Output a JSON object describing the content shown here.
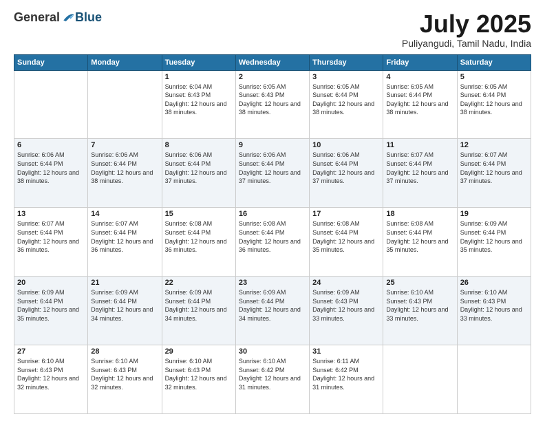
{
  "logo": {
    "general": "General",
    "blue": "Blue"
  },
  "header": {
    "month": "July 2025",
    "location": "Puliyangudi, Tamil Nadu, India"
  },
  "days": [
    "Sunday",
    "Monday",
    "Tuesday",
    "Wednesday",
    "Thursday",
    "Friday",
    "Saturday"
  ],
  "weeks": [
    [
      {
        "day": "",
        "info": ""
      },
      {
        "day": "",
        "info": ""
      },
      {
        "day": "1",
        "info": "Sunrise: 6:04 AM\nSunset: 6:43 PM\nDaylight: 12 hours and 38 minutes."
      },
      {
        "day": "2",
        "info": "Sunrise: 6:05 AM\nSunset: 6:43 PM\nDaylight: 12 hours and 38 minutes."
      },
      {
        "day": "3",
        "info": "Sunrise: 6:05 AM\nSunset: 6:44 PM\nDaylight: 12 hours and 38 minutes."
      },
      {
        "day": "4",
        "info": "Sunrise: 6:05 AM\nSunset: 6:44 PM\nDaylight: 12 hours and 38 minutes."
      },
      {
        "day": "5",
        "info": "Sunrise: 6:05 AM\nSunset: 6:44 PM\nDaylight: 12 hours and 38 minutes."
      }
    ],
    [
      {
        "day": "6",
        "info": "Sunrise: 6:06 AM\nSunset: 6:44 PM\nDaylight: 12 hours and 38 minutes."
      },
      {
        "day": "7",
        "info": "Sunrise: 6:06 AM\nSunset: 6:44 PM\nDaylight: 12 hours and 38 minutes."
      },
      {
        "day": "8",
        "info": "Sunrise: 6:06 AM\nSunset: 6:44 PM\nDaylight: 12 hours and 37 minutes."
      },
      {
        "day": "9",
        "info": "Sunrise: 6:06 AM\nSunset: 6:44 PM\nDaylight: 12 hours and 37 minutes."
      },
      {
        "day": "10",
        "info": "Sunrise: 6:06 AM\nSunset: 6:44 PM\nDaylight: 12 hours and 37 minutes."
      },
      {
        "day": "11",
        "info": "Sunrise: 6:07 AM\nSunset: 6:44 PM\nDaylight: 12 hours and 37 minutes."
      },
      {
        "day": "12",
        "info": "Sunrise: 6:07 AM\nSunset: 6:44 PM\nDaylight: 12 hours and 37 minutes."
      }
    ],
    [
      {
        "day": "13",
        "info": "Sunrise: 6:07 AM\nSunset: 6:44 PM\nDaylight: 12 hours and 36 minutes."
      },
      {
        "day": "14",
        "info": "Sunrise: 6:07 AM\nSunset: 6:44 PM\nDaylight: 12 hours and 36 minutes."
      },
      {
        "day": "15",
        "info": "Sunrise: 6:08 AM\nSunset: 6:44 PM\nDaylight: 12 hours and 36 minutes."
      },
      {
        "day": "16",
        "info": "Sunrise: 6:08 AM\nSunset: 6:44 PM\nDaylight: 12 hours and 36 minutes."
      },
      {
        "day": "17",
        "info": "Sunrise: 6:08 AM\nSunset: 6:44 PM\nDaylight: 12 hours and 35 minutes."
      },
      {
        "day": "18",
        "info": "Sunrise: 6:08 AM\nSunset: 6:44 PM\nDaylight: 12 hours and 35 minutes."
      },
      {
        "day": "19",
        "info": "Sunrise: 6:09 AM\nSunset: 6:44 PM\nDaylight: 12 hours and 35 minutes."
      }
    ],
    [
      {
        "day": "20",
        "info": "Sunrise: 6:09 AM\nSunset: 6:44 PM\nDaylight: 12 hours and 35 minutes."
      },
      {
        "day": "21",
        "info": "Sunrise: 6:09 AM\nSunset: 6:44 PM\nDaylight: 12 hours and 34 minutes."
      },
      {
        "day": "22",
        "info": "Sunrise: 6:09 AM\nSunset: 6:44 PM\nDaylight: 12 hours and 34 minutes."
      },
      {
        "day": "23",
        "info": "Sunrise: 6:09 AM\nSunset: 6:44 PM\nDaylight: 12 hours and 34 minutes."
      },
      {
        "day": "24",
        "info": "Sunrise: 6:09 AM\nSunset: 6:43 PM\nDaylight: 12 hours and 33 minutes."
      },
      {
        "day": "25",
        "info": "Sunrise: 6:10 AM\nSunset: 6:43 PM\nDaylight: 12 hours and 33 minutes."
      },
      {
        "day": "26",
        "info": "Sunrise: 6:10 AM\nSunset: 6:43 PM\nDaylight: 12 hours and 33 minutes."
      }
    ],
    [
      {
        "day": "27",
        "info": "Sunrise: 6:10 AM\nSunset: 6:43 PM\nDaylight: 12 hours and 32 minutes."
      },
      {
        "day": "28",
        "info": "Sunrise: 6:10 AM\nSunset: 6:43 PM\nDaylight: 12 hours and 32 minutes."
      },
      {
        "day": "29",
        "info": "Sunrise: 6:10 AM\nSunset: 6:43 PM\nDaylight: 12 hours and 32 minutes."
      },
      {
        "day": "30",
        "info": "Sunrise: 6:10 AM\nSunset: 6:42 PM\nDaylight: 12 hours and 31 minutes."
      },
      {
        "day": "31",
        "info": "Sunrise: 6:11 AM\nSunset: 6:42 PM\nDaylight: 12 hours and 31 minutes."
      },
      {
        "day": "",
        "info": ""
      },
      {
        "day": "",
        "info": ""
      }
    ]
  ]
}
